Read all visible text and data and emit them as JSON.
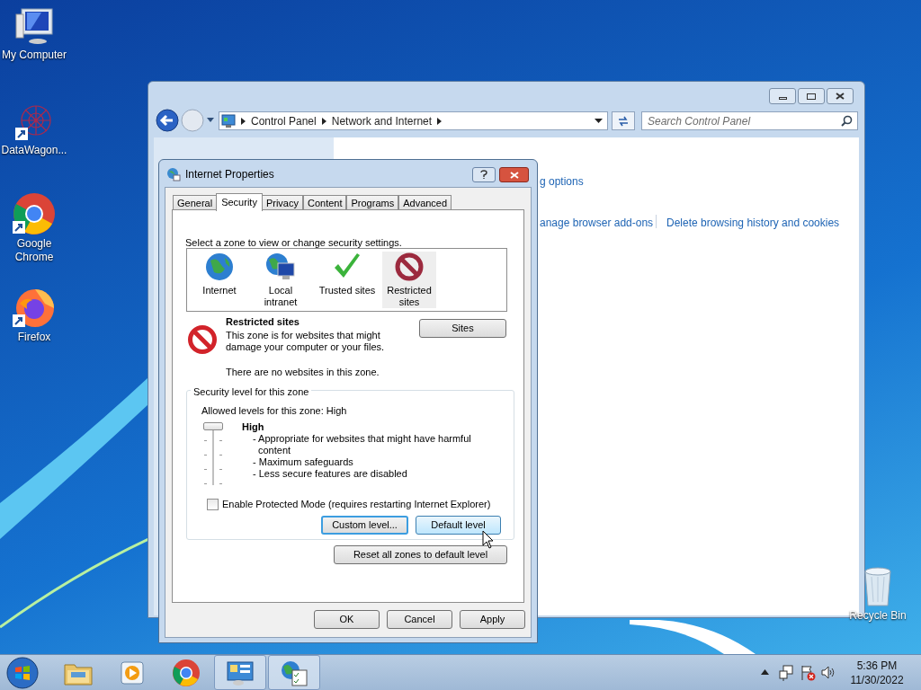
{
  "desktop_icons": [
    {
      "kind": "computer",
      "label": "My Computer"
    },
    {
      "kind": "network",
      "label": "DataWagon..."
    },
    {
      "kind": "chrome",
      "label": "Google Chrome"
    },
    {
      "kind": "firefox",
      "label": "Firefox"
    },
    {
      "kind": "bin",
      "label": "Recycle Bin"
    }
  ],
  "control_panel": {
    "breadcrumbs": [
      "Control Panel",
      "Network and Internet"
    ],
    "search": {
      "placeholder": "Search Control Panel"
    },
    "links": [
      "g options",
      "anage browser add-ons",
      "Delete browsing history and cookies"
    ]
  },
  "dialog": {
    "title": "Internet Properties",
    "tabs": [
      {
        "label": "General",
        "selected": false
      },
      {
        "label": "Security",
        "selected": true
      },
      {
        "label": "Privacy",
        "selected": false
      },
      {
        "label": "Content",
        "selected": false
      },
      {
        "label": "Programs",
        "selected": false
      },
      {
        "label": "Advanced",
        "selected": false
      }
    ],
    "prompt": "Select a zone to view or change security settings.",
    "zones": [
      {
        "kind": "globe",
        "label": "Internet",
        "selected": false
      },
      {
        "kind": "intranet",
        "label": "Local intranet",
        "selected": false
      },
      {
        "kind": "check",
        "label": "Trusted sites",
        "selected": false
      },
      {
        "kind": "blocked",
        "label": "Restricted sites",
        "selected": true
      }
    ],
    "zone_title": "Restricted sites",
    "zone_description": "This zone is for websites that might damage your computer or your files.",
    "zone_note": "There are no websites in this zone.",
    "sites_button": "Sites",
    "security_level": {
      "legend": "Security level for this zone",
      "allowed": "Allowed levels for this zone: High",
      "level": 1,
      "level_name": "High",
      "bullets": [
        "- Appropriate for websites that might have harmful content",
        "- Maximum safeguards",
        "- Less secure features are disabled"
      ]
    },
    "protected_mode": {
      "label": "Enable Protected Mode (requires restarting Internet Explorer)",
      "checked": false
    },
    "level_buttons": [
      {
        "label": "Custom level...",
        "highlighted": false
      },
      {
        "label": "Default level",
        "highlighted": true
      }
    ],
    "reset_button": "Reset all zones to default level",
    "footer_buttons": [
      "OK",
      "Cancel",
      "Apply"
    ]
  },
  "taskbar": {
    "items": [
      {
        "kind": "explorer",
        "active": false
      },
      {
        "kind": "media",
        "active": false
      },
      {
        "kind": "chrome",
        "active": false
      },
      {
        "kind": "control-panel",
        "active": true
      },
      {
        "kind": "internet-options",
        "active": true
      }
    ],
    "time": "5:36 PM",
    "date": "11/30/2022"
  }
}
